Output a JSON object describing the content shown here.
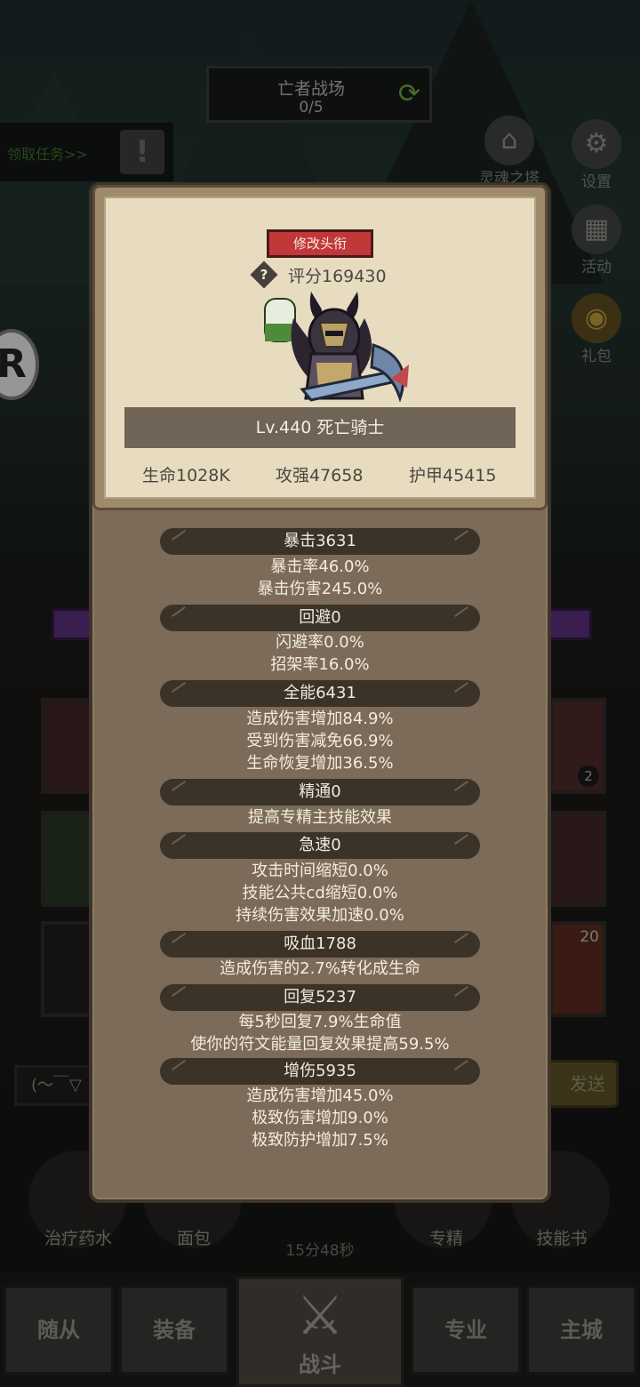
{
  "hud": {
    "stage_title": "亡者战场",
    "stage_progress": "0/5",
    "quest_link": "领取任务>>",
    "soul_tower": "灵魂之塔",
    "settings": "设置",
    "activity": "活动",
    "gift": "礼包",
    "chat_placeholder": "(～￣▽",
    "send": "发送",
    "card_badge_1": "2",
    "card_badge_2": "20",
    "potions": [
      "治疗药水",
      "面包",
      "专精",
      "技能书"
    ],
    "timer": "15分48秒"
  },
  "nav": {
    "items": [
      "随从",
      "装备",
      "专业",
      "主城"
    ],
    "battle": "战斗"
  },
  "profile": {
    "change_title_button": "修改头衔",
    "score_icon": "?",
    "score": "评分169430",
    "level_name": "Lv.440 死亡骑士",
    "hp": "生命1028K",
    "attack": "攻强47658",
    "armor": "护甲45415"
  },
  "stats": [
    {
      "header": "暴击3631",
      "lines": [
        "暴击率46.0%",
        "暴击伤害245.0%"
      ]
    },
    {
      "header": "回避0",
      "lines": [
        "闪避率0.0%",
        "招架率16.0%"
      ]
    },
    {
      "header": "全能6431",
      "lines": [
        "造成伤害增加84.9%",
        "受到伤害减免66.9%",
        "生命恢复增加36.5%"
      ]
    },
    {
      "header": "精通0",
      "lines": [
        "提高专精主技能效果"
      ]
    },
    {
      "header": "急速0",
      "lines": [
        "攻击时间缩短0.0%",
        "技能公共cd缩短0.0%",
        "持续伤害效果加速0.0%"
      ]
    },
    {
      "header": "吸血1788",
      "lines": [
        "造成伤害的2.7%转化成生命"
      ]
    },
    {
      "header": "回复5237",
      "lines": [
        "每5秒回复7.9%生命值",
        "使你的符文能量回复效果提高59.5%"
      ]
    },
    {
      "header": "增伤5935",
      "lines": [
        "造成伤害增加45.0%",
        "极致伤害增加9.0%",
        "极致防护增加7.5%"
      ]
    }
  ]
}
